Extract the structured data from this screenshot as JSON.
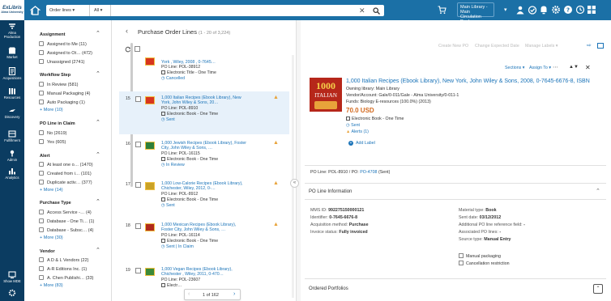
{
  "topbar": {
    "logo_line1": "ExLibris",
    "logo_line2": "Alma University",
    "search_type": "Order lines",
    "search_scope": "All",
    "library": "Main Library - Main",
    "desk": "Circulation Desk"
  },
  "rail": [
    {
      "name": "alma-production",
      "label": "Alma Production"
    },
    {
      "name": "market",
      "label": "Market"
    },
    {
      "name": "acquisitions",
      "label": "Acquisitions"
    },
    {
      "name": "resources",
      "label": "Resources"
    },
    {
      "name": "discovery",
      "label": "Discovery"
    },
    {
      "name": "fulfillment",
      "label": "Fulfillment"
    },
    {
      "name": "admin",
      "label": "Admin"
    },
    {
      "name": "analytics",
      "label": "Analytics"
    },
    {
      "name": "show-more",
      "label": "Show MDE"
    }
  ],
  "facets": {
    "assignment": {
      "title": "Assignment",
      "items": [
        "Assigned to Me (11)",
        "Assigned to Ot… (472)",
        "Unassigned (2741)"
      ]
    },
    "workflow": {
      "title": "Workflow Step",
      "items": [
        "In Review (581)",
        "Manual Packaging (4)",
        "Auto Packaging (1)"
      ],
      "more": "+ More (10)"
    },
    "claim": {
      "title": "PO Line in Claim",
      "items": [
        "No (2619)",
        "Yes (605)"
      ]
    },
    "alert": {
      "title": "Alert",
      "items": [
        "At least one o… (1470)",
        "Created from i… (101)",
        "Duplicate activ… (377)"
      ],
      "more": "+ More (14)"
    },
    "purchase_type": {
      "title": "Purchase Type",
      "items": [
        "Access Service -… (4)",
        "Database - One Ti… (1)",
        "Database - Subsc… (4)"
      ],
      "more": "+ More (30)"
    },
    "vendor": {
      "title": "Vendor",
      "items": [
        "A D & L Vendors (22)",
        "A-R Editions Inc. (1)",
        "A. Chen Publishi… (33)"
      ],
      "more": "+ More (83)"
    }
  },
  "list": {
    "title": "Purchase Order Lines",
    "count": "(1 - 20 of 3,224)",
    "pagination": "1 of 162",
    "partial_top": {
      "title": "York , Wiley, 2008 , 0-7645…",
      "po_line": "PO Line: POL-38912",
      "type": "Electronic Title - One Time",
      "status": "Cancelled"
    },
    "rows": [
      {
        "num": "15",
        "title1": "1,000 Italian Recipes (Ebook Library), New",
        "title2": "York, John Wiley & Sons, 20…",
        "po_line": "PO Line: POL-8910",
        "type": "Electronic Book - One Time",
        "status": "Sent",
        "selected": true,
        "warn": true
      },
      {
        "num": "16",
        "title1": "1,000 Jewish Recipes (Ebook Library), Foster",
        "title2": "City, John Wiley & Sons, …",
        "po_line": "PO Line: POL-16115",
        "type": "Electronic Book - One Time",
        "status": "In Review",
        "selected": false,
        "warn": true
      },
      {
        "num": "17",
        "title1": "1,000 Low-Calorie Recipes (Ebook Library),",
        "title2": "Chichester, Wiley, 2012, 0-…",
        "po_line": "PO Line: POL-8912",
        "type": "Electronic Book - One Time",
        "status": "Sent",
        "selected": false,
        "warn": true
      },
      {
        "num": "18",
        "title1": "1,000 Mexican Recipes (Ebook Library),",
        "title2": "Foster City, John Wiley & Sons, …",
        "po_line": "PO Line: POL-16114",
        "type": "Electronic Book - One Time",
        "status": "Sent | In Claim",
        "selected": false,
        "warn": true
      },
      {
        "num": "19",
        "title1": "1,000 Vegan Recipes (Ebook Library),",
        "title2": "Chichester , Wiley, 2011, 0-470…",
        "po_line": "PO Line: POL-23607",
        "type": "Electr…",
        "status": "",
        "selected": false,
        "warn": false
      }
    ]
  },
  "toolbar": {
    "create": "Create New PO",
    "change_date": "Change Expected Date",
    "manage_labels": "Manage Labels"
  },
  "detail": {
    "sections": "Sections",
    "assign_to": "Assign To",
    "title": "1,000 Italian Recipes (Ebook Library), New York, John Wiley & Sons, 2008, 0-7645-6676-8, ISBN",
    "owning_library": "Owning library: Main Library",
    "vendor_account": "Vendor/Account: Gale/0-011/Gale - Alma University/0-011-1",
    "funds": "Funds: Biology E-resources (100.0%) (2013)",
    "price": "70.0 USD",
    "type": "Electronic Book - One Time",
    "status": "Sent",
    "alerts": "Alerts (1)",
    "add_label": "Add Label",
    "po_info": "PO Line: POL-8910 / PO:",
    "po_link": "PO-4708",
    "po_sent": "(Sent)",
    "info_title": "PO Line Information",
    "left_fields": [
      {
        "k": "MMS ID:",
        "v": "992275150000121"
      },
      {
        "k": "Identifier:",
        "v": "0-7645-6676-8"
      },
      {
        "k": "Acquisition method:",
        "v": "Purchase"
      },
      {
        "k": "Invoice status:",
        "v": "Fully invoiced"
      }
    ],
    "right_fields": [
      {
        "k": "Material type:",
        "v": "Book"
      },
      {
        "k": "Sent date:",
        "v": "03/12/2012"
      },
      {
        "k": "Additional PO line reference field:",
        "v": "-"
      },
      {
        "k": "Associated PO lines:",
        "v": "-"
      },
      {
        "k": "Source type:",
        "v": "Manual Entry"
      }
    ],
    "checkboxes": [
      "Manual packaging",
      "Cancellation restriction"
    ],
    "ordered_portfolios": "Ordered Portfolios",
    "cover_word1": "1000",
    "cover_word2": "ITALIAN"
  }
}
